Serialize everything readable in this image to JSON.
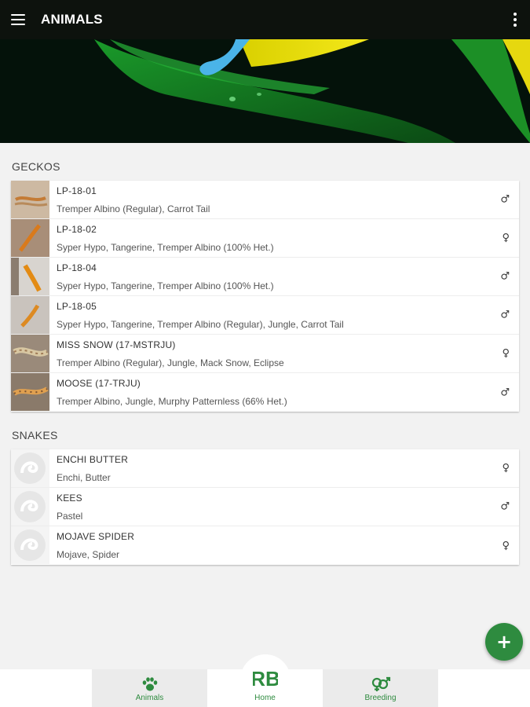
{
  "appbar": {
    "title": "ANIMALS"
  },
  "sections": [
    {
      "title": "GECKOS",
      "animals": [
        {
          "name": "LP-18-01",
          "genes": "Tremper Albino (Regular), Carrot Tail",
          "sex": "♂"
        },
        {
          "name": "LP-18-02",
          "genes": "Syper Hypo, Tangerine, Tremper Albino (100% Het.)",
          "sex": "♀"
        },
        {
          "name": "LP-18-04",
          "genes": "Syper Hypo, Tangerine, Tremper Albino (100% Het.)",
          "sex": "♂"
        },
        {
          "name": "LP-18-05",
          "genes": "Syper Hypo, Tangerine, Tremper Albino (Regular), Jungle, Carrot Tail",
          "sex": "♂"
        },
        {
          "name": "MISS SNOW (17-MSTRJU)",
          "genes": "Tremper Albino (Regular), Jungle, Mack Snow, Eclipse",
          "sex": "♀"
        },
        {
          "name": "MOOSE (17-TRJU)",
          "genes": "Tremper Albino, Jungle, Murphy Patternless (66% Het.)",
          "sex": "♂"
        }
      ]
    },
    {
      "title": "SNAKES",
      "animals": [
        {
          "name": "ENCHI BUTTER",
          "genes": "Enchi, Butter",
          "sex": "♀"
        },
        {
          "name": "KEES",
          "genes": "Pastel",
          "sex": "♂"
        },
        {
          "name": "MOJAVE SPIDER",
          "genes": "Mojave, Spider",
          "sex": "♀"
        }
      ]
    }
  ],
  "fab": {
    "label": "+"
  },
  "bottom_nav": {
    "animals": "Animals",
    "home": "Home",
    "home_logo": "RB",
    "breeding": "Breeding"
  },
  "colors": {
    "appbar": "#0d120d",
    "accent": "#2e8b3f",
    "background": "#f2f2f2"
  },
  "icons": {
    "menu": "hamburger-icon",
    "overflow": "more-vert-icon",
    "animals": "paw-icon",
    "breeding": "gender-symbols-icon",
    "placeholder": "snake-placeholder-icon"
  }
}
